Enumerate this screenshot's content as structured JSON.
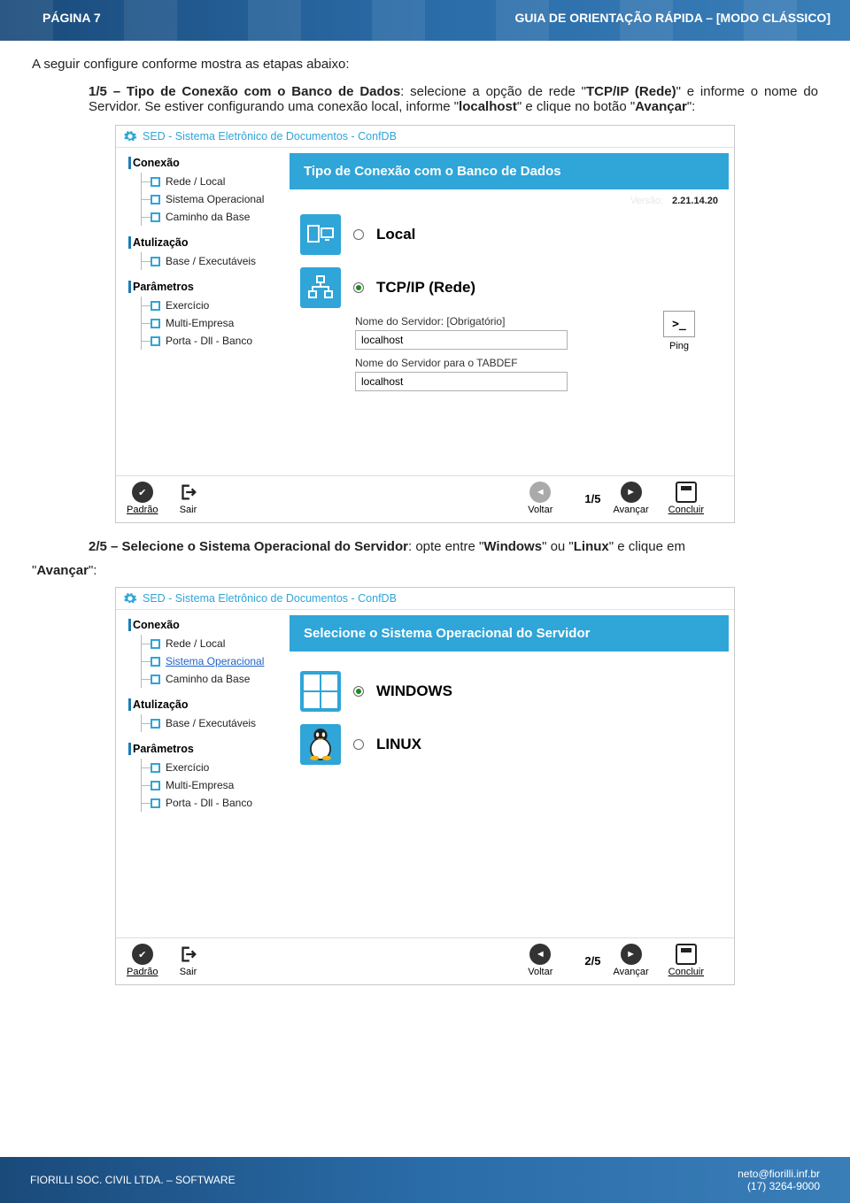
{
  "header": {
    "page_label": "PÁGINA 7",
    "title": "GUIA DE ORIENTAÇÃO RÁPIDA – [MODO CLÁSSICO]"
  },
  "intro": "A seguir configure conforme mostra as etapas abaixo:",
  "step1": {
    "lead": "1/5 – Tipo de Conexão com o Banco de Dados",
    "tail1": ": selecione a opção de rede \"",
    "hl1": "TCP/IP (Rede)",
    "tail2": "\" e informe o nome do Servidor. Se estiver configurando uma conexão local, informe \"",
    "hl2": "localhost",
    "tail3": "\" e clique no botão \"",
    "hl3": "Avançar",
    "tail4": "\":"
  },
  "step2": {
    "lead": "2/5 – Selecione o Sistema Operacional do Servidor",
    "tail1": ": opte entre \"",
    "hl1": "Windows",
    "tail2": "\" ou \"",
    "hl2": "Linux",
    "tail3": "\" e clique em"
  },
  "avancar_quote": "\"Avançar\":",
  "window": {
    "title": "SED - Sistema Eletrônico de Documentos - ConfDB",
    "version_label": "Versão:",
    "version": "2.21.14.20",
    "tree": {
      "sec1": "Conexão",
      "sec1_items": [
        "Rede / Local",
        "Sistema Operacional",
        "Caminho da Base"
      ],
      "sec2": "Atulização",
      "sec2_items": [
        "Base / Executáveis"
      ],
      "sec3": "Parâmetros",
      "sec3_items": [
        "Exercício",
        "Multi-Empresa",
        "Porta - Dll - Banco"
      ]
    },
    "panel1_title": "Tipo de Conexão com o Banco de Dados",
    "opt_local": "Local",
    "opt_tcp": "TCP/IP (Rede)",
    "fld1_label": "Nome do Servidor: [Obrigatório]",
    "fld1_value": "localhost",
    "fld2_label": "Nome do Servidor para o TABDEF",
    "fld2_value": "localhost",
    "ping": "Ping",
    "ping_symbol": ">_",
    "panel2_title": "Selecione o Sistema Operacional do Servidor",
    "opt_win": "WINDOWS",
    "opt_linux": "LINUX",
    "footer": {
      "padrao": "Padrão",
      "sair": "Sair",
      "voltar": "Voltar",
      "avancar": "Avançar",
      "concluir": "Concluir",
      "pager1": "1/5",
      "pager2": "2/5"
    }
  },
  "footer": {
    "company": "FIORILLI SOC. CIVIL LTDA. – SOFTWARE",
    "email": "neto@fiorilli.inf.br",
    "phone": "(17) 3264-9000"
  }
}
